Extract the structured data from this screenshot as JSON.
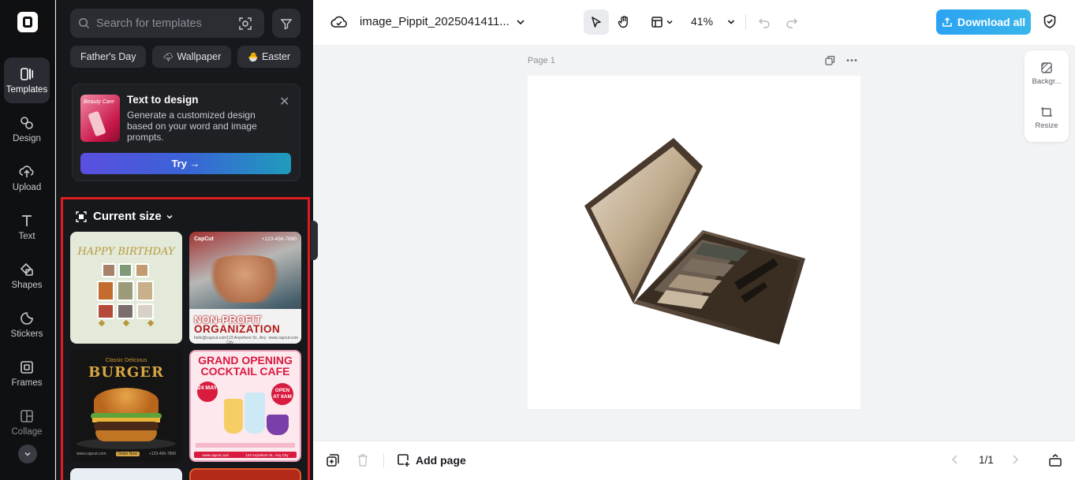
{
  "rail": {
    "items": [
      {
        "label": "Templates",
        "icon": "templates-icon",
        "active": true
      },
      {
        "label": "Design",
        "icon": "design-icon"
      },
      {
        "label": "Upload",
        "icon": "upload-icon"
      },
      {
        "label": "Text",
        "icon": "text-icon"
      },
      {
        "label": "Shapes",
        "icon": "shapes-icon"
      },
      {
        "label": "Stickers",
        "icon": "stickers-icon"
      },
      {
        "label": "Frames",
        "icon": "frames-icon"
      },
      {
        "label": "Collage",
        "icon": "collage-icon"
      }
    ]
  },
  "search": {
    "placeholder": "Search for templates"
  },
  "chips": [
    {
      "label": "Father's Day",
      "emoji": ""
    },
    {
      "label": "Wallpaper",
      "emoji": "🌩"
    },
    {
      "label": "Easter",
      "emoji": "🐣"
    }
  ],
  "text_to_design": {
    "thumb_text": "Beauty Care",
    "title": "Text to design",
    "description": "Generate a customized design based on your word and image prompts.",
    "try_label": "Try →"
  },
  "current_size": {
    "title": "Current size",
    "templates": {
      "birthday": {
        "title": "HAPPY BIRTHDAY"
      },
      "nonprofit": {
        "brand": "CapCut",
        "phone": "+123-456-7890",
        "line1": "NON-PROFIT",
        "line2": "ORGANIZATION",
        "footer": [
          "hello@capcut.com",
          "123 Anywhere St., Any City",
          "www.capcut.com"
        ]
      },
      "burger": {
        "subtitle": "Classic Delicious",
        "title": "BURGER",
        "footer": [
          "www.capcut.com",
          "Order Now",
          "+123-456-7890"
        ]
      },
      "cocktail": {
        "title": "GRAND OPENING COCKTAIL CAFE",
        "date": "24 MAY",
        "open": "OPEN AT 8AM",
        "footer": [
          "www.capcut.com",
          "123 Anywhere St., Any City"
        ]
      }
    }
  },
  "topbar": {
    "filename": "image_Pippit_2025041411...",
    "zoom": "41%",
    "download_label": "Download all"
  },
  "canvas": {
    "page_label": "Page 1"
  },
  "side_float": [
    {
      "label": "Backgr...",
      "icon": "background-icon"
    },
    {
      "label": "Resize",
      "icon": "resize-icon"
    }
  ],
  "bottombar": {
    "add_page_label": "Add page",
    "page_counter": "1/1"
  },
  "colors": {
    "accent": "#2ba2f2",
    "highlight_border": "#e01b22",
    "panel_bg": "#17181b"
  }
}
